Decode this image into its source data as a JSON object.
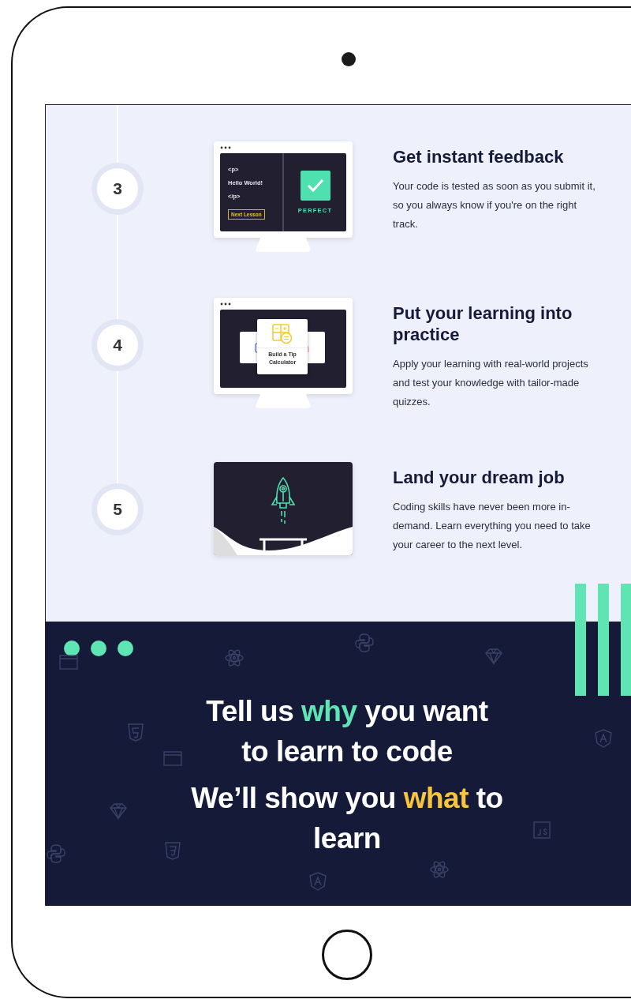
{
  "steps": [
    {
      "number": "3",
      "title": "Get instant feedback",
      "body": "Your code is tested as soon as you submit it, so you always know if you're on the right track.",
      "illustration": {
        "kind": "feedback",
        "code_lines": [
          "<p>",
          "Hello World!",
          "</p>"
        ],
        "button": "Next Lesson",
        "result": "PERFECT"
      }
    },
    {
      "number": "4",
      "title": "Put your learning into practice",
      "body": "Apply your learning with real-world projects and test your knowledge with tailor-made quizzes.",
      "illustration": {
        "kind": "project",
        "card_title": "Build a Tip Calculator"
      }
    },
    {
      "number": "5",
      "title": "Land your dream job",
      "body": "Coding skills have never been more in-demand. Learn everything you need to take your career to the next level.",
      "illustration": {
        "kind": "launch"
      }
    }
  ],
  "banner": {
    "headlines": [
      {
        "before": "Tell us ",
        "highlight": "why",
        "after": " you want to learn to code",
        "color": "#5ee5b3"
      },
      {
        "before": "We’ll show you ",
        "highlight": "what",
        "after": " to learn",
        "color": "#f8c53a"
      }
    ]
  }
}
